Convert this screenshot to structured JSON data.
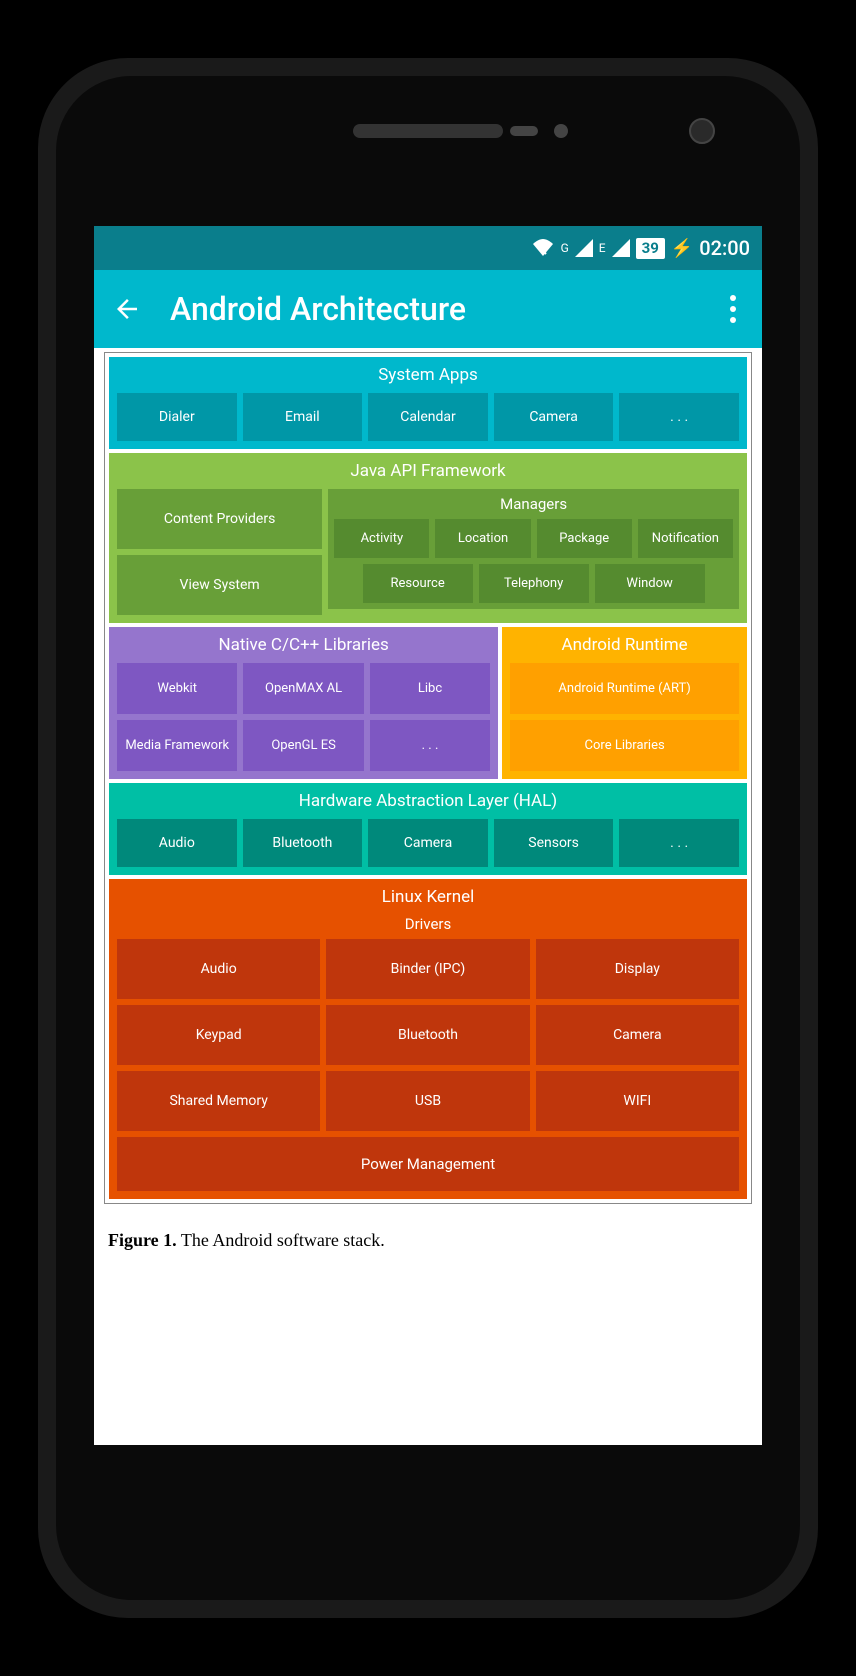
{
  "status_bar": {
    "sig1_label": "G",
    "sig2_label": "E",
    "battery_pct": "39",
    "time": "02:00"
  },
  "app_bar": {
    "title": "Android Architecture"
  },
  "architecture": {
    "system_apps": {
      "title": "System Apps",
      "items": [
        "Dialer",
        "Email",
        "Calendar",
        "Camera",
        ". . ."
      ]
    },
    "java_api": {
      "title": "Java API Framework",
      "left": [
        "Content Providers",
        "View System"
      ],
      "managers": {
        "title": "Managers",
        "row1": [
          "Activity",
          "Location",
          "Package",
          "Notification"
        ],
        "row2": [
          "Resource",
          "Telephony",
          "Window"
        ]
      }
    },
    "native_libs": {
      "title": "Native C/C++ Libraries",
      "rows": [
        [
          "Webkit",
          "OpenMAX AL",
          "Libc"
        ],
        [
          "Media Framework",
          "OpenGL ES",
          ". . ."
        ]
      ]
    },
    "android_runtime": {
      "title": "Android Runtime",
      "items": [
        "Android Runtime (ART)",
        "Core Libraries"
      ]
    },
    "hal": {
      "title": "Hardware Abstraction Layer (HAL)",
      "items": [
        "Audio",
        "Bluetooth",
        "Camera",
        "Sensors",
        ". . ."
      ]
    },
    "linux": {
      "title": "Linux Kernel",
      "drivers_title": "Drivers",
      "driver_rows": [
        [
          "Audio",
          "Binder (IPC)",
          "Display"
        ],
        [
          "Keypad",
          "Bluetooth",
          "Camera"
        ],
        [
          "Shared Memory",
          "USB",
          "WIFI"
        ]
      ],
      "power_mgmt": "Power Management"
    }
  },
  "caption": {
    "label": "Figure 1.",
    "text": " The Android software stack."
  }
}
